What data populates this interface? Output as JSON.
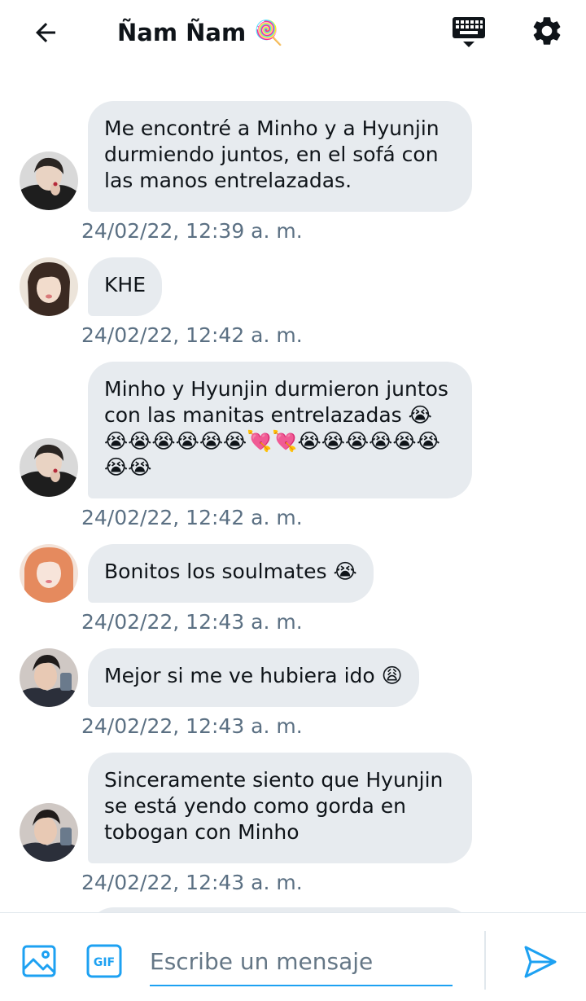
{
  "header": {
    "title": "Ñam Ñam 🍭",
    "back_icon": "arrow-left-icon",
    "keyboard_icon": "keyboard-icon",
    "settings_icon": "gear-icon"
  },
  "messages": [
    {
      "text": "Me encontré a Minho y a Hyunjin durmiendo juntos, en el sofá con las manos entrelazadas.",
      "time": "24/02/22, 12:39 a. m.",
      "avatar_color": "#3a3a3a"
    },
    {
      "text": "KHE",
      "time": "24/02/22, 12:42 a. m.",
      "avatar_color": "#c8b4a4"
    },
    {
      "text": "Minho y Hyunjin durmieron juntos con las manitas entrelazadas 😭😭😭😭😭😭😭💘💘😭😭😭😭😭😭😭😭",
      "time": "24/02/22, 12:42 a. m.",
      "avatar_color": "#3a3a3a"
    },
    {
      "text": "Bonitos los soulmates 😭",
      "time": "24/02/22, 12:43 a. m.",
      "avatar_color": "#e8a07a"
    },
    {
      "text": "Mejor si me ve hubiera ido 😩",
      "time": "24/02/22, 12:43 a. m.",
      "avatar_color": "#5a4a48"
    },
    {
      "text": "Sinceramente siento que Hyunjin se está yendo como gorda en tobogan con Minho",
      "time": "24/02/22, 12:43 a. m.",
      "avatar_color": "#5a4a48"
    }
  ],
  "composer": {
    "placeholder": "Escribe un mensaje",
    "image_icon": "image-icon",
    "gif_icon": "gif-icon",
    "gif_label": "GIF",
    "send_icon": "send-icon"
  },
  "colors": {
    "accent": "#1da1f2",
    "bubble": "#e7ebef",
    "timestamp": "#5b7083",
    "text": "#0f1419"
  }
}
